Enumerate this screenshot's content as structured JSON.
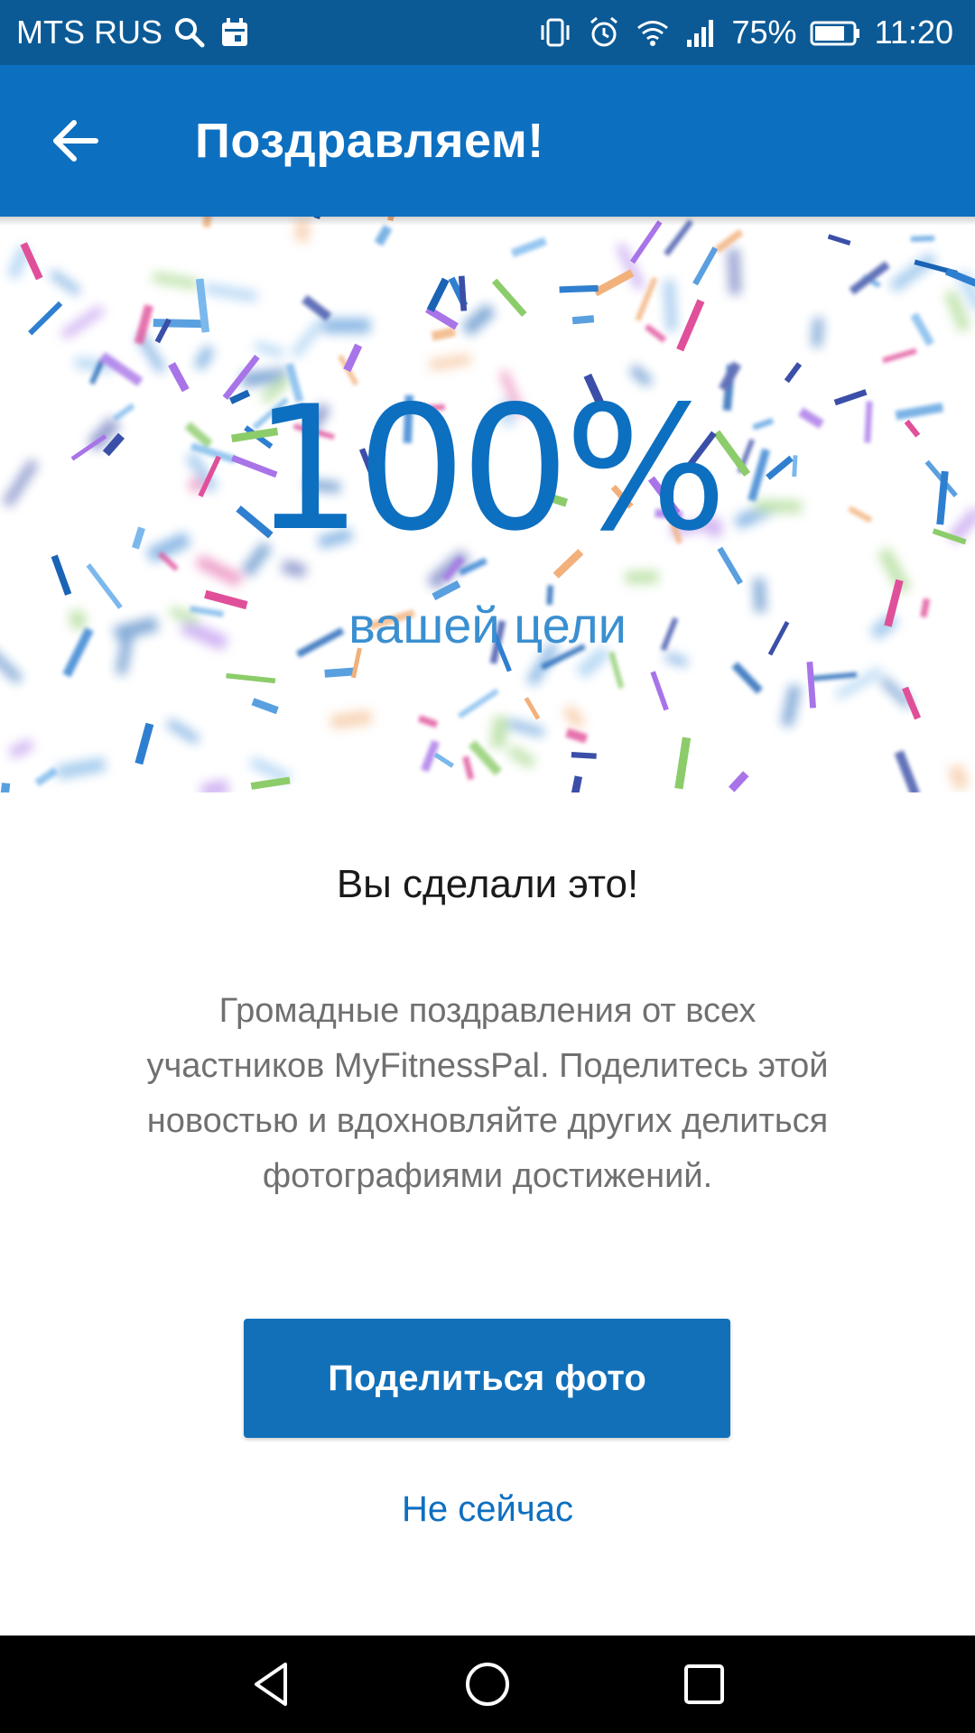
{
  "status_bar": {
    "carrier": "MTS RUS",
    "battery_percent": "75%",
    "time": "11:20",
    "icons": [
      "search-icon",
      "calendar-icon",
      "vibrate-icon",
      "alarm-icon",
      "wifi-icon",
      "signal-icon",
      "battery-icon"
    ]
  },
  "app_bar": {
    "title": "Поздравляем!",
    "back_icon": "arrow-back-icon"
  },
  "hero": {
    "percent": "100%",
    "caption": "вашей цели"
  },
  "content": {
    "headline": "Вы сделали это!",
    "body": "Громадные поздравления от всех участников MyFitnessPal. Поделитесь этой новостью и вдохновляйте других делиться фотографиями достижений.",
    "share_button": "Поделиться фото",
    "not_now": "Не сейчас"
  },
  "nav_bar": {
    "icons": [
      "back-triangle-icon",
      "home-circle-icon",
      "recents-square-icon"
    ]
  },
  "colors": {
    "status_bar": "#0b5a96",
    "app_bar": "#0d6fc0",
    "accent": "#0d6fc0",
    "button": "#1270b9"
  }
}
